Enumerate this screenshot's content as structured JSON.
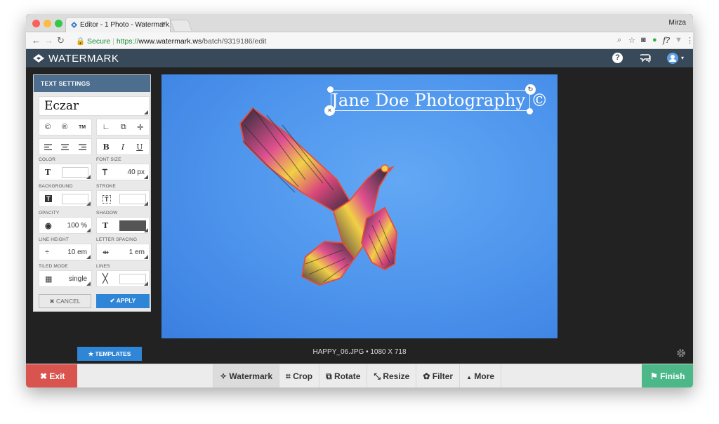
{
  "browser": {
    "tab_title": "Editor - 1 Photo - Watermark.w",
    "tab_close": "×",
    "profile_name": "Mirza",
    "url_secure_label": "Secure",
    "url_scheme": "https://",
    "url_host": "www.watermark.ws",
    "url_path": "/batch/9319186/edit",
    "separator": "|"
  },
  "app": {
    "brand": "WATERMARK",
    "help_icon": "?",
    "colors": {
      "header": "#38495a",
      "primary": "#2f86d6",
      "exit": "#d9534f",
      "finish": "#4cb88a"
    }
  },
  "text_settings": {
    "title": "TEXT SETTINGS",
    "font": "Eczar",
    "symbol_buttons": [
      "©",
      "®",
      "TM"
    ],
    "align_buttons": [
      "left",
      "center",
      "right"
    ],
    "style_buttons": [
      "B",
      "I",
      "U"
    ],
    "labels": {
      "color": "COLOR",
      "font_size": "FONT SIZE",
      "background": "BACKGROUND",
      "stroke": "STROKE",
      "opacity": "OPACITY",
      "shadow": "SHADOW",
      "line_height": "LINE HEIGHT",
      "letter_spacing": "LETTER SPACING",
      "tiled_mode": "TILED MODE",
      "lines": "LINES"
    },
    "color_value": "#ffffff",
    "font_size": "40 px",
    "background_value": "#ffffff",
    "stroke_value": "#ffffff",
    "opacity": "100 %",
    "shadow_color": "#555555",
    "line_height": "10 em",
    "letter_spacing": "1 em",
    "tiled_mode": "single",
    "lines_value": "#ffffff",
    "cancel": "✖ CANCEL",
    "apply": "✔ APPLY"
  },
  "canvas": {
    "watermark_text": "Jane Doe Photography ©",
    "remove_handle": "×",
    "rotate_handle": "↻"
  },
  "file_info": "HAPPY_06.JPG • 1080 X 718",
  "templates_button": "★ TEMPLATES",
  "toolbar": {
    "exit": "✖ Exit",
    "finish": "⚑ Finish",
    "tools": [
      {
        "label": "Watermark",
        "icon": "watermark-icon",
        "active": true
      },
      {
        "label": "Crop",
        "icon": "crop-icon"
      },
      {
        "label": "Rotate",
        "icon": "rotate-icon"
      },
      {
        "label": "Resize",
        "icon": "resize-icon"
      },
      {
        "label": "Filter",
        "icon": "filter-icon"
      },
      {
        "label": "More",
        "icon": "caret-up-icon"
      }
    ],
    "tool_glyphs": [
      "✧",
      "⌗",
      "⧉",
      "⤡",
      "✿",
      "▲"
    ]
  }
}
